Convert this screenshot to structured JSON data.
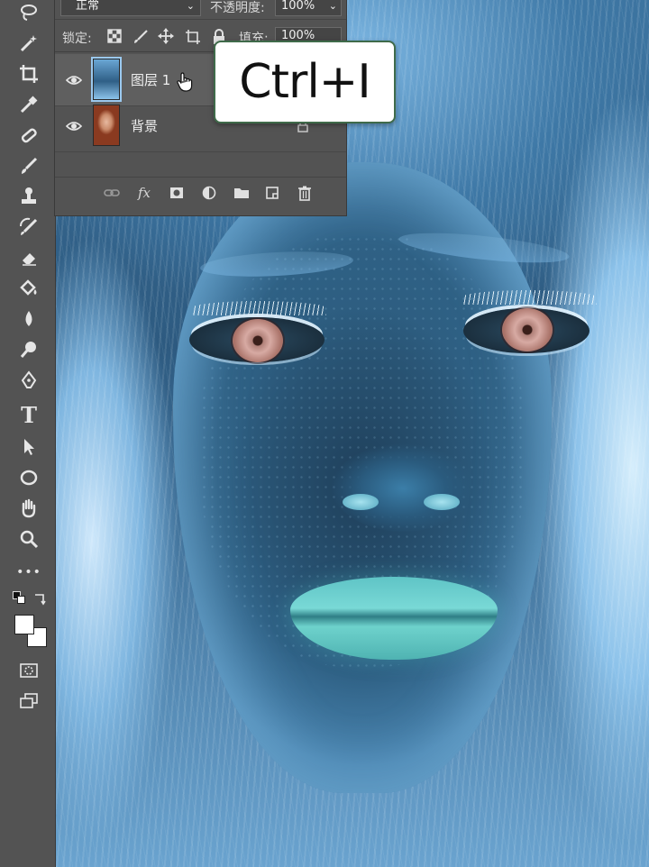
{
  "app": "Photoshop",
  "top_bar": {
    "blend_mode": "正常",
    "opacity_label": "不透明度:",
    "opacity_value": "100%",
    "lock_label": "锁定:",
    "fill_label": "填充:",
    "fill_value": "100%"
  },
  "layers": [
    {
      "name": "图层 1",
      "visible": true,
      "selected": true
    },
    {
      "name": "背景",
      "visible": true,
      "selected": false,
      "locked": true
    }
  ],
  "panel_footer_icons": [
    "link-icon",
    "fx-icon",
    "mask-icon",
    "adjustment-icon",
    "folder-icon",
    "new-layer-icon",
    "trash-icon"
  ],
  "fx_label": "fx",
  "shortcut": "Ctrl+I",
  "tools": [
    "lasso-icon",
    "magic-wand-icon",
    "crop-icon",
    "eyedropper-icon",
    "healing-brush-icon",
    "brush-icon",
    "stamp-icon",
    "history-brush-icon",
    "eraser-icon",
    "paint-bucket-icon",
    "blur-icon",
    "dodge-icon",
    "pen-icon",
    "type-icon",
    "path-select-icon",
    "ellipse-icon",
    "hand-icon",
    "zoom-icon",
    "more-icon"
  ],
  "type_tool_glyph": "T",
  "more_glyph": "•••",
  "colors": {
    "ui_panel": "#535353",
    "foreground": "#ffffff",
    "background": "#ffffff",
    "callout_border": "#3f6b4a"
  }
}
